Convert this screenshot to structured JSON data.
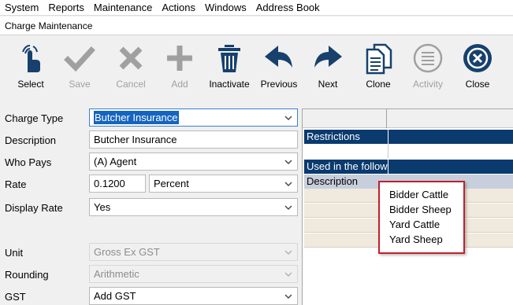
{
  "menubar": {
    "items": [
      "System",
      "Reports",
      "Maintenance",
      "Actions",
      "Windows",
      "Address Book"
    ]
  },
  "window": {
    "title": "Charge Maintenance"
  },
  "toolbar": {
    "buttons": [
      {
        "label": "Select",
        "icon": "hand-pointer-icon",
        "enabled": true
      },
      {
        "label": "Save",
        "icon": "checkmark-icon",
        "enabled": false
      },
      {
        "label": "Cancel",
        "icon": "x-icon",
        "enabled": false
      },
      {
        "label": "Add",
        "icon": "plus-icon",
        "enabled": false
      },
      {
        "label": "Inactivate",
        "icon": "trash-icon",
        "enabled": true
      },
      {
        "label": "Previous",
        "icon": "arrow-left-icon",
        "enabled": true
      },
      {
        "label": "Next",
        "icon": "arrow-right-icon",
        "enabled": true
      },
      {
        "label": "Clone",
        "icon": "copy-icon",
        "enabled": true
      },
      {
        "label": "Activity",
        "icon": "list-icon",
        "enabled": false
      },
      {
        "label": "Close",
        "icon": "close-circle-icon",
        "enabled": true
      }
    ]
  },
  "form": {
    "charge_type": {
      "label": "Charge Type",
      "value": "Butcher Insurance"
    },
    "description": {
      "label": "Description",
      "value": "Butcher Insurance"
    },
    "who_pays": {
      "label": "Who Pays",
      "value": "(A) Agent"
    },
    "rate": {
      "label": "Rate",
      "value": "0.1200",
      "unit": "Percent"
    },
    "display_rate": {
      "label": "Display Rate",
      "value": "Yes"
    },
    "unit": {
      "label": "Unit",
      "value": "Gross Ex GST"
    },
    "rounding": {
      "label": "Rounding",
      "value": "Arithmetic"
    },
    "gst": {
      "label": "GST",
      "value": "Add GST"
    }
  },
  "grid": {
    "restrictions_label": "Restrictions",
    "used_in_label": "Used in the follow",
    "description_header": "Description"
  },
  "popup": {
    "items": [
      "Bidder Cattle",
      "Bidder Sheep",
      "Yard Cattle",
      "Yard Sheep"
    ]
  },
  "colors": {
    "accent_blue": "#0a3a6e",
    "icon_navy": "#17406d",
    "disabled_gray": "#a0a0a0",
    "highlight_red": "#c0202b"
  }
}
